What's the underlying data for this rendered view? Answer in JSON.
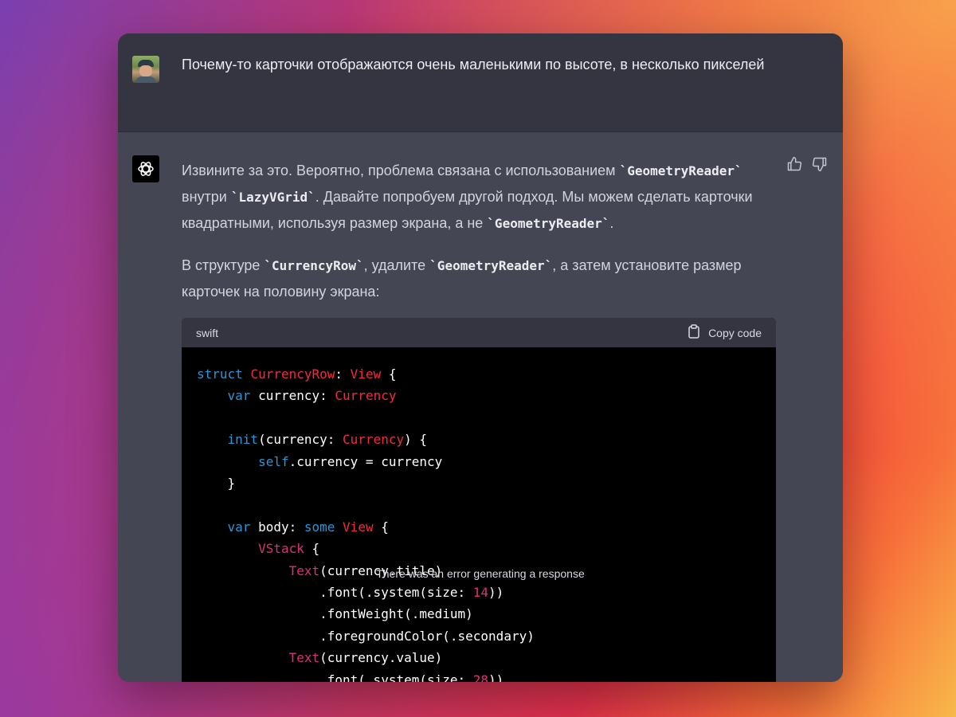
{
  "user_message": {
    "text": "Почему-то карточки отображаются очень маленькими по высоте, в несколько пикселей"
  },
  "assistant_message": {
    "p1_a": "Извините за это. Вероятно, проблема связана с использованием ",
    "p1_code1": "`GeometryReader`",
    "p1_b": " внутри ",
    "p1_code2": "`LazyVGrid`",
    "p1_c": ". Давайте попробуем другой подход. Мы можем сделать карточки квадратными, используя размер экрана, а не ",
    "p1_code3": "`GeometryReader`",
    "p1_d": ".",
    "p2_a": "В структуре ",
    "p2_code1": "`CurrencyRow`",
    "p2_b": ", удалите ",
    "p2_code2": "`GeometryReader`",
    "p2_c": ", а затем установите размер карточек на половину экрана:"
  },
  "code_block": {
    "language": "swift",
    "copy_label": "Copy code",
    "lines": [
      [
        {
          "t": "struct",
          "c": "k"
        },
        {
          "t": " "
        },
        {
          "t": "CurrencyRow",
          "c": "t"
        },
        {
          "t": ": "
        },
        {
          "t": "View",
          "c": "t"
        },
        {
          "t": " {"
        }
      ],
      [
        {
          "t": "    "
        },
        {
          "t": "var",
          "c": "k"
        },
        {
          "t": " currency: "
        },
        {
          "t": "Currency",
          "c": "t"
        }
      ],
      [
        {
          "t": ""
        }
      ],
      [
        {
          "t": "    "
        },
        {
          "t": "init",
          "c": "k"
        },
        {
          "t": "(currency: "
        },
        {
          "t": "Currency",
          "c": "t"
        },
        {
          "t": ") {"
        }
      ],
      [
        {
          "t": "        "
        },
        {
          "t": "self",
          "c": "k"
        },
        {
          "t": ".currency = currency"
        }
      ],
      [
        {
          "t": "    }"
        }
      ],
      [
        {
          "t": ""
        }
      ],
      [
        {
          "t": "    "
        },
        {
          "t": "var",
          "c": "k"
        },
        {
          "t": " body: "
        },
        {
          "t": "some",
          "c": "k"
        },
        {
          "t": " "
        },
        {
          "t": "View",
          "c": "t"
        },
        {
          "t": " {"
        }
      ],
      [
        {
          "t": "        "
        },
        {
          "t": "VStack",
          "c": "n"
        },
        {
          "t": " {"
        }
      ],
      [
        {
          "t": "            "
        },
        {
          "t": "Text",
          "c": "n"
        },
        {
          "t": "(currency.title)"
        }
      ],
      [
        {
          "t": "                .font(.system(size: "
        },
        {
          "t": "14",
          "c": "n"
        },
        {
          "t": "))"
        }
      ],
      [
        {
          "t": "                .fontWeight(.medium)"
        }
      ],
      [
        {
          "t": "                .foregroundColor(.secondary)"
        }
      ],
      [
        {
          "t": "            "
        },
        {
          "t": "Text",
          "c": "n"
        },
        {
          "t": "(currency.value)"
        }
      ],
      [
        {
          "t": "                .font(.system(size: "
        },
        {
          "t": "28",
          "c": "n"
        },
        {
          "t": "))"
        }
      ]
    ]
  },
  "status_toast": "There was an error generating a response",
  "colors": {
    "keyword": "#2e95d3",
    "type": "#f22c3d",
    "accent": "#df3079"
  },
  "icons": {
    "thumbs_up": "thumbs-up-icon",
    "thumbs_down": "thumbs-down-icon",
    "clipboard": "clipboard-icon",
    "logo": "openai-logo-icon"
  }
}
